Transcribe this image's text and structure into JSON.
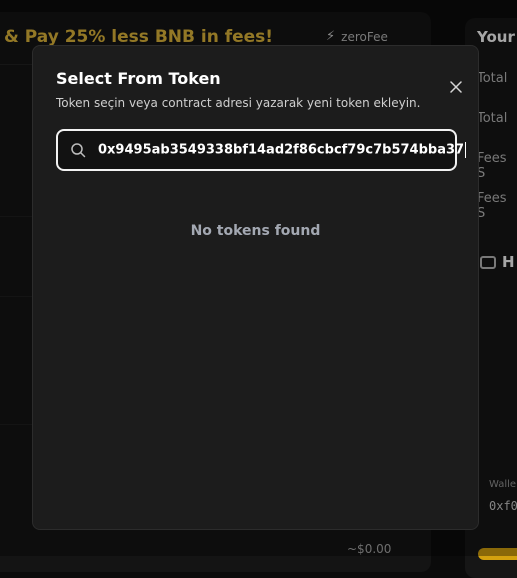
{
  "background": {
    "banner_text": "& Pay 25% less BNB in fees!",
    "zero_fee_label": "zeroFee",
    "right_panel_title": "Your",
    "right_rows": [
      "Total",
      "Total",
      "Fees S",
      "Fees S"
    ],
    "wallet_heading": "H",
    "wallet_label": "Walle",
    "wallet_address": "0xf0",
    "usd_value": "~$0.00"
  },
  "modal": {
    "title": "Select From Token",
    "subtitle": "Token seçin veya contract adresi yazarak yeni token ekleyin.",
    "close_icon": "close-icon",
    "search": {
      "icon": "search-icon",
      "value": "0x9495ab3549338bf14ad2f86cbcf79c7b574bba37"
    },
    "empty_message": "No tokens found"
  },
  "colors": {
    "accent": "#e2b93b",
    "modal_bg": "#1c1c1c",
    "muted_text": "#a3a8b2"
  }
}
